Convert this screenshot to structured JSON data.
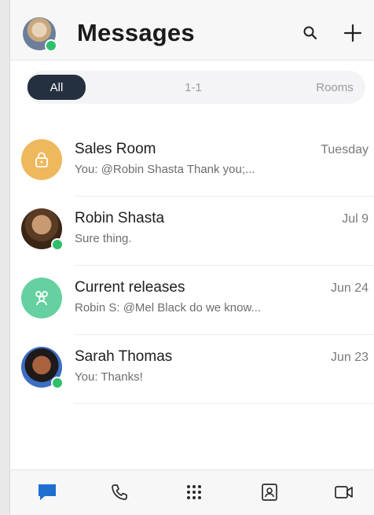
{
  "header": {
    "title": "Messages",
    "search_icon": "search-icon",
    "add_icon": "plus-icon",
    "avatar_status": "online"
  },
  "filters": {
    "items": [
      {
        "label": "All",
        "selected": true
      },
      {
        "label": "1-1",
        "selected": false
      },
      {
        "label": "Rooms",
        "selected": false
      }
    ]
  },
  "conversations": [
    {
      "name": "Sales Room",
      "preview": "You: @Robin Shasta Thank you;...",
      "time": "Tuesday",
      "avatar": {
        "type": "icon",
        "icon": "lock-icon",
        "color": "#efb85c"
      }
    },
    {
      "name": "Robin Shasta",
      "preview": "Sure thing.",
      "time": "Jul 9",
      "avatar": {
        "type": "photo",
        "status": "online"
      }
    },
    {
      "name": "Current releases",
      "preview": "Robin S: @Mel Black do we know...",
      "time": "Jun 24",
      "avatar": {
        "type": "icon",
        "icon": "group-icon",
        "color": "#66d1a0"
      }
    },
    {
      "name": "Sarah Thomas",
      "preview": "You: Thanks!",
      "time": "Jun 23",
      "avatar": {
        "type": "photo",
        "status": "online"
      }
    }
  ],
  "bottom_nav": {
    "items": [
      {
        "icon": "message-icon",
        "active": true,
        "color": "#1f6fd1"
      },
      {
        "icon": "phone-icon",
        "active": false
      },
      {
        "icon": "apps-grid-icon",
        "active": false
      },
      {
        "icon": "contacts-icon",
        "active": false
      },
      {
        "icon": "video-icon",
        "active": false
      }
    ]
  },
  "colors": {
    "accent": "#1f6fd1",
    "online": "#2fbf6a",
    "pill_selected": "#24303f"
  }
}
